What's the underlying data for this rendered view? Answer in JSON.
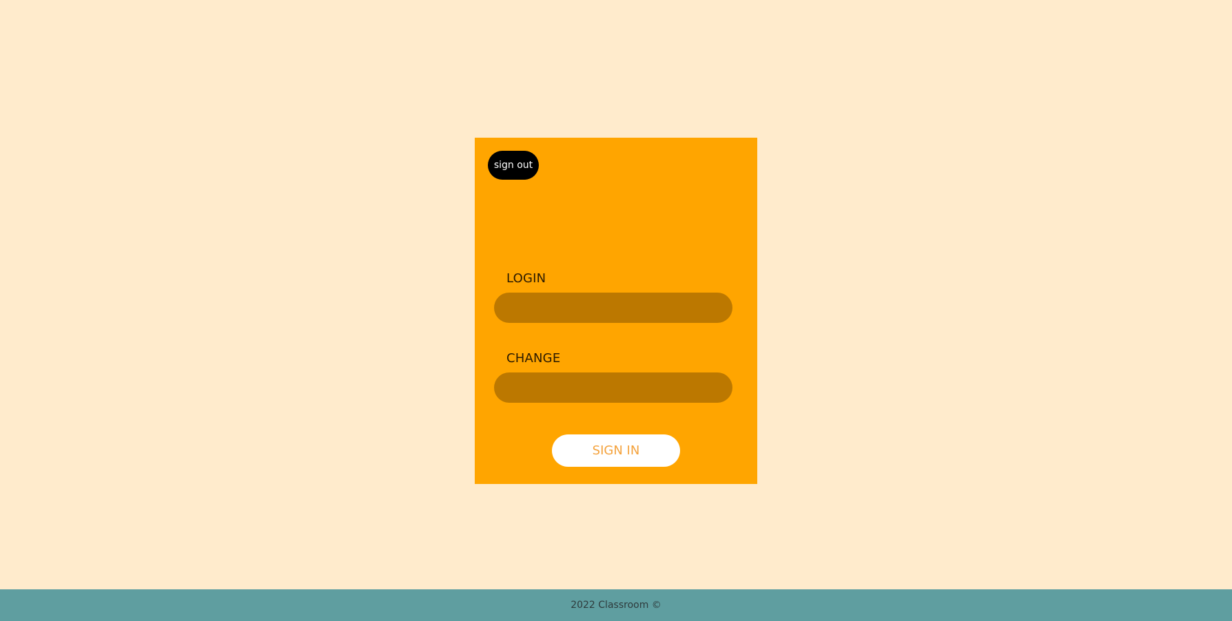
{
  "colors": {
    "page_background": "#FFEBCC",
    "card_background": "#FFA500",
    "input_background": "#BC7800",
    "signout_background": "#000000",
    "signin_text": "#F4A23C",
    "footer_background": "#5F9EA0"
  },
  "card": {
    "signout_label": "sign out",
    "login_label": "LOGIN",
    "login_value": "",
    "change_label": "CHANGE",
    "change_value": "",
    "signin_label": "SIGN IN"
  },
  "footer": {
    "text": "2022 Classroom ©"
  }
}
